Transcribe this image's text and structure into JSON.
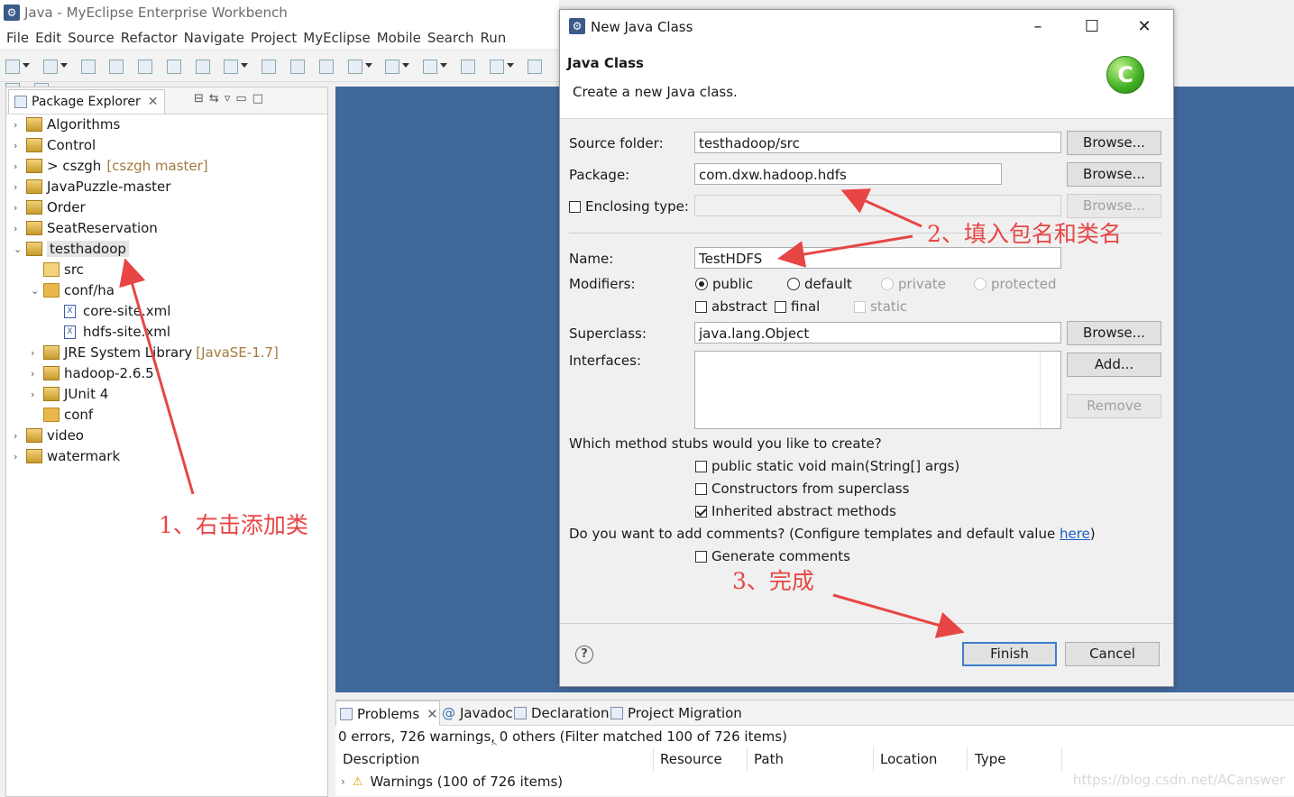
{
  "window": {
    "title": "Java - MyEclipse Enterprise Workbench"
  },
  "menu": [
    "File",
    "Edit",
    "Source",
    "Refactor",
    "Navigate",
    "Project",
    "MyEclipse",
    "Mobile",
    "Search",
    "Run"
  ],
  "package_explorer": {
    "tab_label": "Package Explorer",
    "items": [
      {
        "label": "Algorithms"
      },
      {
        "label": "Control"
      },
      {
        "label": "> cszgh",
        "decoration": "[cszgh master]"
      },
      {
        "label": "JavaPuzzle-master"
      },
      {
        "label": "Order"
      },
      {
        "label": "SeatReservation"
      },
      {
        "label": "testhadoop"
      },
      {
        "label": "src"
      },
      {
        "label": "conf/ha"
      },
      {
        "label": "core-site.xml"
      },
      {
        "label": "hdfs-site.xml"
      },
      {
        "label": "JRE System Library",
        "decoration": "[JavaSE-1.7]"
      },
      {
        "label": "hadoop-2.6.5"
      },
      {
        "label": "JUnit 4"
      },
      {
        "label": "conf"
      },
      {
        "label": "video"
      },
      {
        "label": "watermark"
      }
    ]
  },
  "problems_view": {
    "tabs": [
      "Problems",
      "Javadoc",
      "Declaration",
      "Project Migration"
    ],
    "summary": "0 errors, 726 warnings, 0 others (Filter matched 100 of 726 items)",
    "columns": [
      "Description",
      "Resource",
      "Path",
      "Location",
      "Type"
    ],
    "rows": [
      {
        "description": "Warnings (100 of 726 items)"
      }
    ]
  },
  "dialog": {
    "title": "New Java Class",
    "heading": "Java Class",
    "subheading": "Create a new Java class.",
    "source_folder": {
      "label": "Source folder:",
      "value": "testhadoop/src"
    },
    "package": {
      "label": "Package:",
      "value": "com.dxw.hadoop.hdfs"
    },
    "enclosing_type": {
      "label": "Enclosing type:",
      "value": "",
      "checked": false
    },
    "name": {
      "label": "Name:",
      "value": "TestHDFS"
    },
    "modifiers": {
      "label": "Modifiers:",
      "access": [
        "public",
        "default",
        "private",
        "protected"
      ],
      "selected": "public",
      "flags": [
        "abstract",
        "final",
        "static"
      ]
    },
    "superclass": {
      "label": "Superclass:",
      "value": "java.lang.Object"
    },
    "interfaces": {
      "label": "Interfaces:"
    },
    "buttons": {
      "browse": "Browse...",
      "add": "Add...",
      "remove": "Remove",
      "finish": "Finish",
      "cancel": "Cancel"
    },
    "stubs_question": "Which method stubs would you like to create?",
    "stubs": [
      {
        "label": "public static void main(String[] args)",
        "checked": false
      },
      {
        "label": "Constructors from superclass",
        "checked": false
      },
      {
        "label": "Inherited abstract methods",
        "checked": true
      }
    ],
    "comments_question_prefix": "Do you want to add comments? (Configure templates and default value ",
    "comments_link": "here",
    "comments_question_suffix": ")",
    "generate_comments": {
      "label": "Generate comments",
      "checked": false
    }
  },
  "annotations": {
    "step1": "1、右击添加类",
    "step2": "2、填入包名和类名",
    "step3": "3、完成",
    "color": "#e84545"
  },
  "watermark": "https://blog.csdn.net/ACanswer",
  "colors": {
    "editor_bg": "#41689a",
    "accent": "#3c7fd0"
  }
}
